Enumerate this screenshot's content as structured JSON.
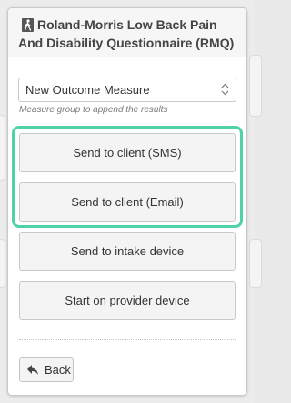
{
  "popover": {
    "title_line1": "Roland-Morris Low Back Pain",
    "title_line2": "And Disability Questionnaire (RMQ)",
    "header_icon": "walking-person-icon"
  },
  "measure_select": {
    "value": "New Outcome Measure",
    "hint": "Measure group to append the results",
    "icon": "select-arrows-icon"
  },
  "actions": {
    "send_sms": "Send to client (SMS)",
    "send_email": "Send to client (Email)",
    "send_intake": "Send to intake device",
    "start_provider": "Start on provider device"
  },
  "back": {
    "label": "Back",
    "icon": "reply-arrow-icon"
  },
  "colors": {
    "highlight": "#4fd1aa",
    "button_bg": "#f4f4f4",
    "border": "#c9c9c9",
    "header_bg": "#f6f6f6"
  }
}
